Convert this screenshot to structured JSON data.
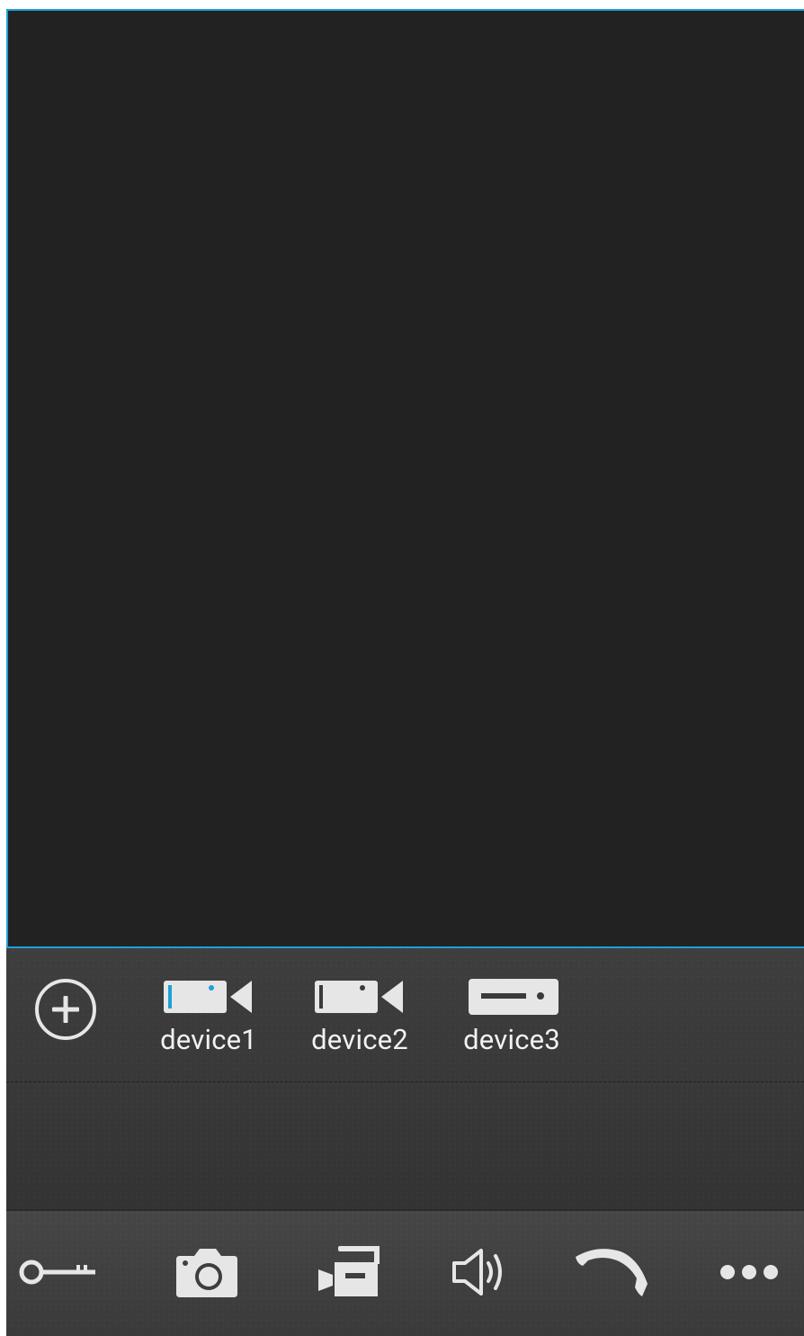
{
  "video": {
    "state": "no-signal"
  },
  "devices": [
    {
      "label": "device1",
      "icon": "camera-icon",
      "selected": true
    },
    {
      "label": "device2",
      "icon": "camera-icon",
      "selected": false
    },
    {
      "label": "device3",
      "icon": "nvr-icon",
      "selected": false
    }
  ],
  "toolbar": {
    "items": [
      {
        "icon": "key-icon"
      },
      {
        "icon": "camera-snapshot-icon"
      },
      {
        "icon": "video-record-icon"
      },
      {
        "icon": "speaker-icon"
      },
      {
        "icon": "phone-icon"
      },
      {
        "icon": "more-icon"
      }
    ]
  },
  "colors": {
    "accent": "#1fa0d8",
    "video_bg": "#222222",
    "panel_bg": "#3a3a3a",
    "icon": "#e6e6e6"
  }
}
